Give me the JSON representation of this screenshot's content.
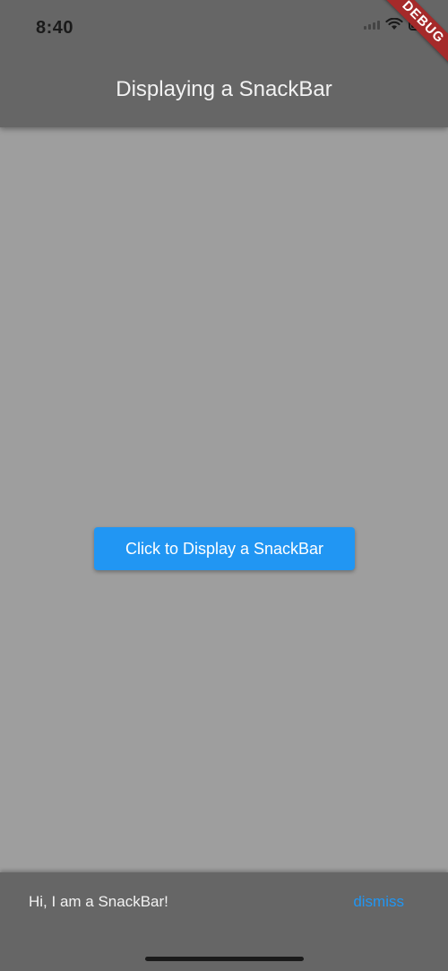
{
  "status_bar": {
    "time": "8:40"
  },
  "debug_banner": {
    "label": "DEBUG"
  },
  "app_bar": {
    "title": "Displaying a SnackBar"
  },
  "main": {
    "button_label": "Click to Display a SnackBar"
  },
  "snackbar": {
    "message": "Hi, I am a SnackBar!",
    "action_label": "dismiss"
  },
  "colors": {
    "app_bar": "#666666",
    "background": "#9e9e9e",
    "accent": "#2196f3",
    "debug_banner": "#a52a2a"
  }
}
